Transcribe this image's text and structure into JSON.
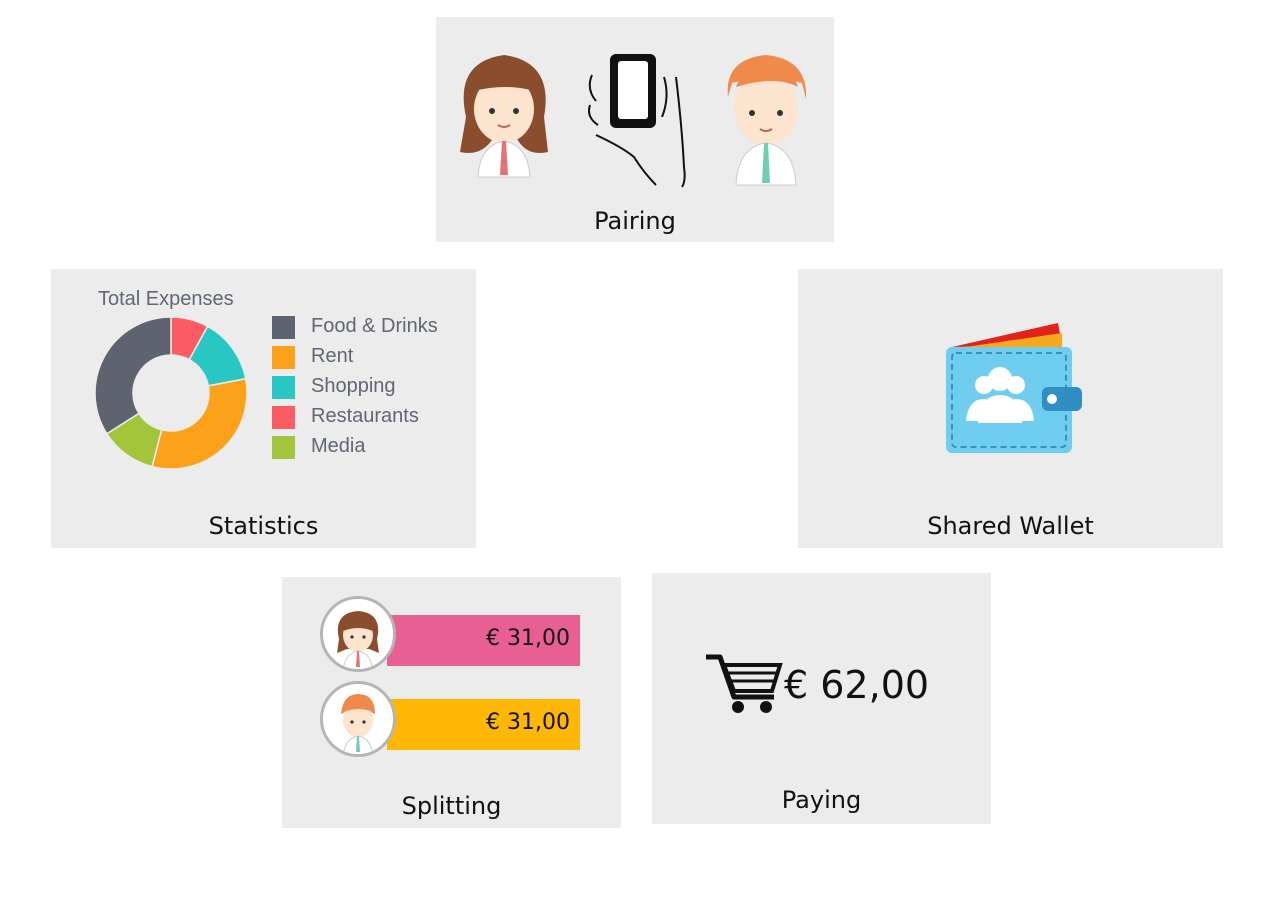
{
  "panels": {
    "pairing": {
      "label": "Pairing"
    },
    "statistics": {
      "label": "Statistics"
    },
    "shared_wallet": {
      "label": "Shared Wallet"
    },
    "splitting": {
      "label": "Splitting"
    },
    "paying": {
      "label": "Paying"
    }
  },
  "splitting": {
    "shares": [
      {
        "amount": "€ 31,00",
        "color": "#e85f93"
      },
      {
        "amount": "€ 31,00",
        "color": "#fdb704"
      }
    ]
  },
  "paying": {
    "total": "€ 62,00",
    "icon": "shopping-cart-icon"
  },
  "wallet": {
    "icon": "shared-wallet-icon",
    "wallet_color": "#6fcdf0"
  },
  "chart_data": {
    "type": "pie",
    "title": "Total Expenses",
    "categories": [
      "Food & Drinks",
      "Rent",
      "Shopping",
      "Restaurants",
      "Media"
    ],
    "values": [
      34,
      32,
      14,
      8,
      12
    ],
    "colors": [
      "#5f6370",
      "#fba21a",
      "#28c7c4",
      "#fb5c63",
      "#a3c53b"
    ],
    "legend": "right"
  }
}
